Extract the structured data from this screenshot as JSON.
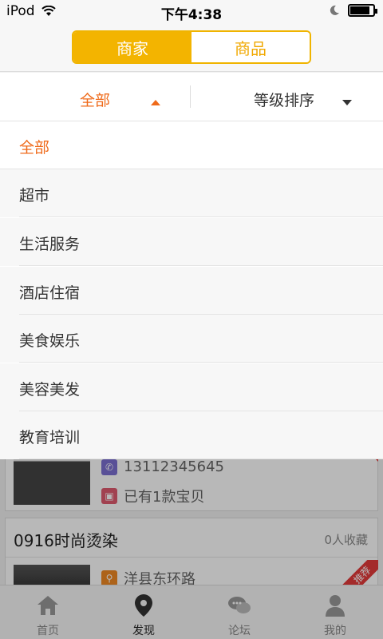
{
  "status_bar": {
    "device": "iPod",
    "time": "下午4:38",
    "battery_level": 0.85
  },
  "segment": {
    "tabs": [
      {
        "label": "商家",
        "active": true
      },
      {
        "label": "商品",
        "active": false
      }
    ]
  },
  "filters": {
    "category_label": "全部",
    "sort_label": "等级排序"
  },
  "dropdown": {
    "items": [
      {
        "label": "全部",
        "selected": true
      },
      {
        "label": "超市"
      },
      {
        "label": "生活服务"
      },
      {
        "label": "酒店住宿"
      },
      {
        "label": "美食娱乐"
      },
      {
        "label": "美容美发"
      },
      {
        "label": "教育培训"
      }
    ]
  },
  "list": {
    "card1": {
      "phone": "13112345645",
      "items_text": "已有1款宝贝"
    },
    "card2": {
      "name": "0916时尚烫染",
      "collect_text": "0人收藏",
      "address": "洋县东环路",
      "badge": "推荐"
    }
  },
  "tabbar": {
    "tabs": [
      {
        "label": "首页",
        "icon": "home-icon"
      },
      {
        "label": "发现",
        "icon": "location-pin-icon",
        "active": true
      },
      {
        "label": "论坛",
        "icon": "chat-bubbles-icon"
      },
      {
        "label": "我的",
        "icon": "user-icon"
      }
    ]
  },
  "colors": {
    "accent_yellow": "#f3b400",
    "accent_orange": "#ef6a1a",
    "badge_red": "#e43b3b"
  }
}
